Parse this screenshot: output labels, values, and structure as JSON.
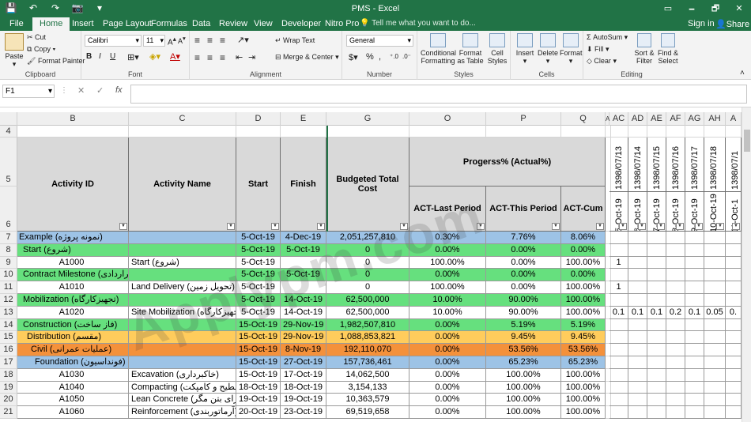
{
  "window": {
    "title": "PMS - Excel",
    "min": "🗕",
    "restore": "🗗",
    "close": "✕",
    "opts": "▭"
  },
  "tabs": [
    "File",
    "Home",
    "Insert",
    "Page Layout",
    "Formulas",
    "Data",
    "Review",
    "View",
    "Developer",
    "Nitro Pro"
  ],
  "active_tab": "Home",
  "tell_me": "Tell me what you want to do...",
  "sign_in": "Sign in",
  "share": "Share",
  "ribbon": {
    "clipboard": {
      "label": "Clipboard",
      "paste": "Paste",
      "cut": "Cut",
      "copy": "Copy",
      "format_painter": "Format Painter"
    },
    "font": {
      "label": "Font",
      "name": "Calibri",
      "size": "11",
      "bold": "B",
      "italic": "I",
      "underline": "U"
    },
    "alignment": {
      "label": "Alignment",
      "wrap": "Wrap Text",
      "merge": "Merge & Center"
    },
    "number": {
      "label": "Number",
      "format": "General",
      "currency": "$",
      "percent": "%",
      "comma": ","
    },
    "styles": {
      "label": "Styles",
      "cond": "Conditional Formatting",
      "table": "Format as Table",
      "cell": "Cell Styles"
    },
    "cells": {
      "label": "Cells",
      "insert": "Insert",
      "delete": "Delete",
      "format": "Format"
    },
    "editing": {
      "label": "Editing",
      "autosum": "AutoSum",
      "fill": "Fill",
      "clear": "Clear",
      "sort": "Sort & Filter",
      "find": "Find & Select"
    }
  },
  "formula_bar": {
    "name_box": "F1",
    "fx": "fx",
    "cancel": "✕",
    "enter": "✓",
    "value": ""
  },
  "columns": [
    "B",
    "C",
    "D",
    "E",
    "G",
    "O",
    "P",
    "Q",
    "AC",
    "AD",
    "AE",
    "AF",
    "AG",
    "AH",
    "A"
  ],
  "headers": {
    "activity_id": "Activity ID",
    "activity_name": "Activity Name",
    "start": "Start",
    "finish": "Finish",
    "budget": "Budgeted Total Cost",
    "progress": "Progerss% (Actual%)",
    "last": "ACT-Last Period",
    "this": "ACT-This Period",
    "cum": "ACT-Cum",
    "dates_top": [
      "1398/07/13",
      "1398/07/14",
      "1398/07/15",
      "1398/07/16",
      "1398/07/17",
      "1398/07/18",
      "1398/07/1"
    ],
    "dates_bottom": [
      "5-Oct-19",
      "6-Oct-19",
      "7-Oct-19",
      "8-Oct-19",
      "9-Oct-19",
      "10-Oct-19",
      "11-Oct-1"
    ]
  },
  "rows": [
    {
      "n": "7",
      "id": "Example (نمونه پروژه)",
      "name": "",
      "start": "5-Oct-19",
      "finish": "4-Dec-19",
      "budget": "2,051,257,810",
      "last": "0.30%",
      "this": "7.76%",
      "cum": "8.06%",
      "daily": [
        "",
        "",
        "",
        "",
        "",
        "",
        ""
      ],
      "color": "#9dc3e6",
      "indent": 0
    },
    {
      "n": "8",
      "id": "Start (شروع)",
      "name": "",
      "start": "5-Oct-19",
      "finish": "5-Oct-19",
      "budget": "0",
      "last": "0.00%",
      "this": "0.00%",
      "cum": "0.00%",
      "daily": [
        "",
        "",
        "",
        "",
        "",
        "",
        ""
      ],
      "color": "#66e07e",
      "indent": 1
    },
    {
      "n": "9",
      "id": "A1000",
      "name": "Start (شروع)",
      "start": "5-Oct-19",
      "finish": "",
      "budget": "0",
      "last": "100.00%",
      "this": "0.00%",
      "cum": "100.00%",
      "daily": [
        "1",
        "",
        "",
        "",
        "",
        "",
        ""
      ],
      "color": "#ffffff",
      "indent": 2
    },
    {
      "n": "10",
      "id": "Contract Milestone (مایلستون های قراردادی)",
      "name": "",
      "start": "5-Oct-19",
      "finish": "5-Oct-19",
      "budget": "0",
      "last": "0.00%",
      "this": "0.00%",
      "cum": "0.00%",
      "daily": [
        "",
        "",
        "",
        "",
        "",
        "",
        ""
      ],
      "color": "#66e07e",
      "indent": 1
    },
    {
      "n": "11",
      "id": "A1010",
      "name": "Land Delivery (تحویل زمین)",
      "start": "5-Oct-19",
      "finish": "",
      "budget": "0",
      "last": "100.00%",
      "this": "0.00%",
      "cum": "100.00%",
      "daily": [
        "1",
        "",
        "",
        "",
        "",
        "",
        ""
      ],
      "color": "#ffffff",
      "indent": 2
    },
    {
      "n": "12",
      "id": "Mobilization (تجهیزکارگاه)",
      "name": "",
      "start": "5-Oct-19",
      "finish": "14-Oct-19",
      "budget": "62,500,000",
      "last": "10.00%",
      "this": "90.00%",
      "cum": "100.00%",
      "daily": [
        "",
        "",
        "",
        "",
        "",
        "",
        ""
      ],
      "color": "#66e07e",
      "indent": 1
    },
    {
      "n": "13",
      "id": "A1020",
      "name": "Site Mobilization (تجهیزکارگاه)",
      "start": "5-Oct-19",
      "finish": "14-Oct-19",
      "budget": "62,500,000",
      "last": "10.00%",
      "this": "90.00%",
      "cum": "100.00%",
      "daily": [
        "0.1",
        "0.1",
        "0.1",
        "0.2",
        "0.1",
        "0.05",
        "0."
      ],
      "color": "#ffffff",
      "indent": 2
    },
    {
      "n": "14",
      "id": "Construction (فاز ساخت)",
      "name": "",
      "start": "15-Oct-19",
      "finish": "29-Nov-19",
      "budget": "1,982,507,810",
      "last": "0.00%",
      "this": "5.19%",
      "cum": "5.19%",
      "daily": [
        "",
        "",
        "",
        "",
        "",
        "",
        ""
      ],
      "color": "#66e07e",
      "indent": 1
    },
    {
      "n": "15",
      "id": "Distribution (مقسم)",
      "name": "",
      "start": "15-Oct-19",
      "finish": "29-Nov-19",
      "budget": "1,088,853,821",
      "last": "0.00%",
      "this": "9.45%",
      "cum": "9.45%",
      "daily": [
        "",
        "",
        "",
        "",
        "",
        "",
        ""
      ],
      "color": "#ffcc5c",
      "indent": 2
    },
    {
      "n": "16",
      "id": "Civil (عملیات عمرانی)",
      "name": "",
      "start": "15-Oct-19",
      "finish": "8-Nov-19",
      "budget": "192,110,070",
      "last": "0.00%",
      "this": "53.56%",
      "cum": "53.56%",
      "daily": [
        "",
        "",
        "",
        "",
        "",
        "",
        ""
      ],
      "color": "#f4913b",
      "indent": 3
    },
    {
      "n": "17",
      "id": "Foundation (فونداسیون)",
      "name": "",
      "start": "15-Oct-19",
      "finish": "27-Oct-19",
      "budget": "157,736,461",
      "last": "0.00%",
      "this": "65.23%",
      "cum": "65.23%",
      "daily": [
        "",
        "",
        "",
        "",
        "",
        "",
        ""
      ],
      "color": "#9dc3e6",
      "indent": 4
    },
    {
      "n": "18",
      "id": "A1030",
      "name": "Excavation (خاکبرداری)",
      "start": "15-Oct-19",
      "finish": "17-Oct-19",
      "budget": "14,062,500",
      "last": "0.00%",
      "this": "100.00%",
      "cum": "100.00%",
      "daily": [
        "",
        "",
        "",
        "",
        "",
        "",
        ""
      ],
      "color": "#ffffff",
      "indent": 2
    },
    {
      "n": "19",
      "id": "A1040",
      "name": "Compacting (تسطیح و کامپکت)",
      "start": "18-Oct-19",
      "finish": "18-Oct-19",
      "budget": "3,154,133",
      "last": "0.00%",
      "this": "100.00%",
      "cum": "100.00%",
      "daily": [
        "",
        "",
        "",
        "",
        "",
        "",
        ""
      ],
      "color": "#ffffff",
      "indent": 2
    },
    {
      "n": "20",
      "id": "A1050",
      "name": "Lean Concrete (اجرای بتن مگر)",
      "start": "19-Oct-19",
      "finish": "19-Oct-19",
      "budget": "10,363,579",
      "last": "0.00%",
      "this": "100.00%",
      "cum": "100.00%",
      "daily": [
        "",
        "",
        "",
        "",
        "",
        "",
        ""
      ],
      "color": "#ffffff",
      "indent": 2
    },
    {
      "n": "21",
      "id": "A1060",
      "name": "Reinforcement (آرماتوربندی)",
      "start": "20-Oct-19",
      "finish": "23-Oct-19",
      "budget": "69,519,658",
      "last": "0.00%",
      "this": "100.00%",
      "cum": "100.00%",
      "daily": [
        "",
        "",
        "",
        "",
        "",
        "",
        ""
      ],
      "color": "#ffffff",
      "indent": 2
    }
  ],
  "row_numbers_header": [
    "4",
    "5",
    "6"
  ],
  "watermark": "Applypm.com"
}
